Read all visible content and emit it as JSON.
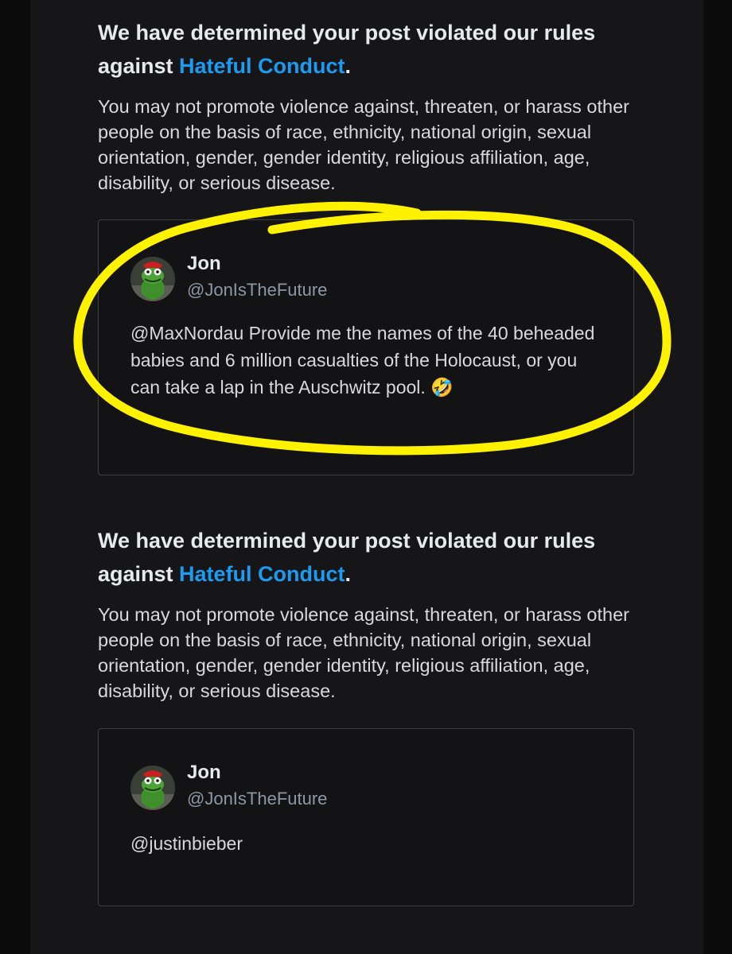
{
  "notices": [
    {
      "heading_prefix": "We have determined your post violated our rules against",
      "policy_link": "Hateful Conduct",
      "heading_suffix": ".",
      "description": "You may not promote violence against, threaten, or harass other people on the basis of race, ethnicity, national origin, sexual orientation, gender, gender identity, religious affiliation, age, disability, or serious disease.",
      "post": {
        "author_name": "Jon",
        "author_handle": "@JonIsTheFuture",
        "text": "@MaxNordau Provide me the names of the 40 beheaded babies and 6 million casualties of the Holocaust, or you can take a lap in the Auschwitz pool. 🤣"
      }
    },
    {
      "heading_prefix": "We have determined your post violated our rules against",
      "policy_link": "Hateful Conduct",
      "heading_suffix": ".",
      "description": "You may not promote violence against, threaten, or harass other people on the basis of race, ethnicity, national origin, sexual orientation, gender, gender identity, religious affiliation, age, disability, or serious disease.",
      "post": {
        "author_name": "Jon",
        "author_handle": "@JonIsTheFuture",
        "text": "@justinbieber"
      }
    }
  ],
  "colors": {
    "background": "#0b0b0c",
    "panel": "#161618",
    "link": "#1d9bf0",
    "highlight": "#fff200",
    "handle": "#8b98a5"
  },
  "icons": {
    "avatar": "kermit-avatar-icon"
  }
}
